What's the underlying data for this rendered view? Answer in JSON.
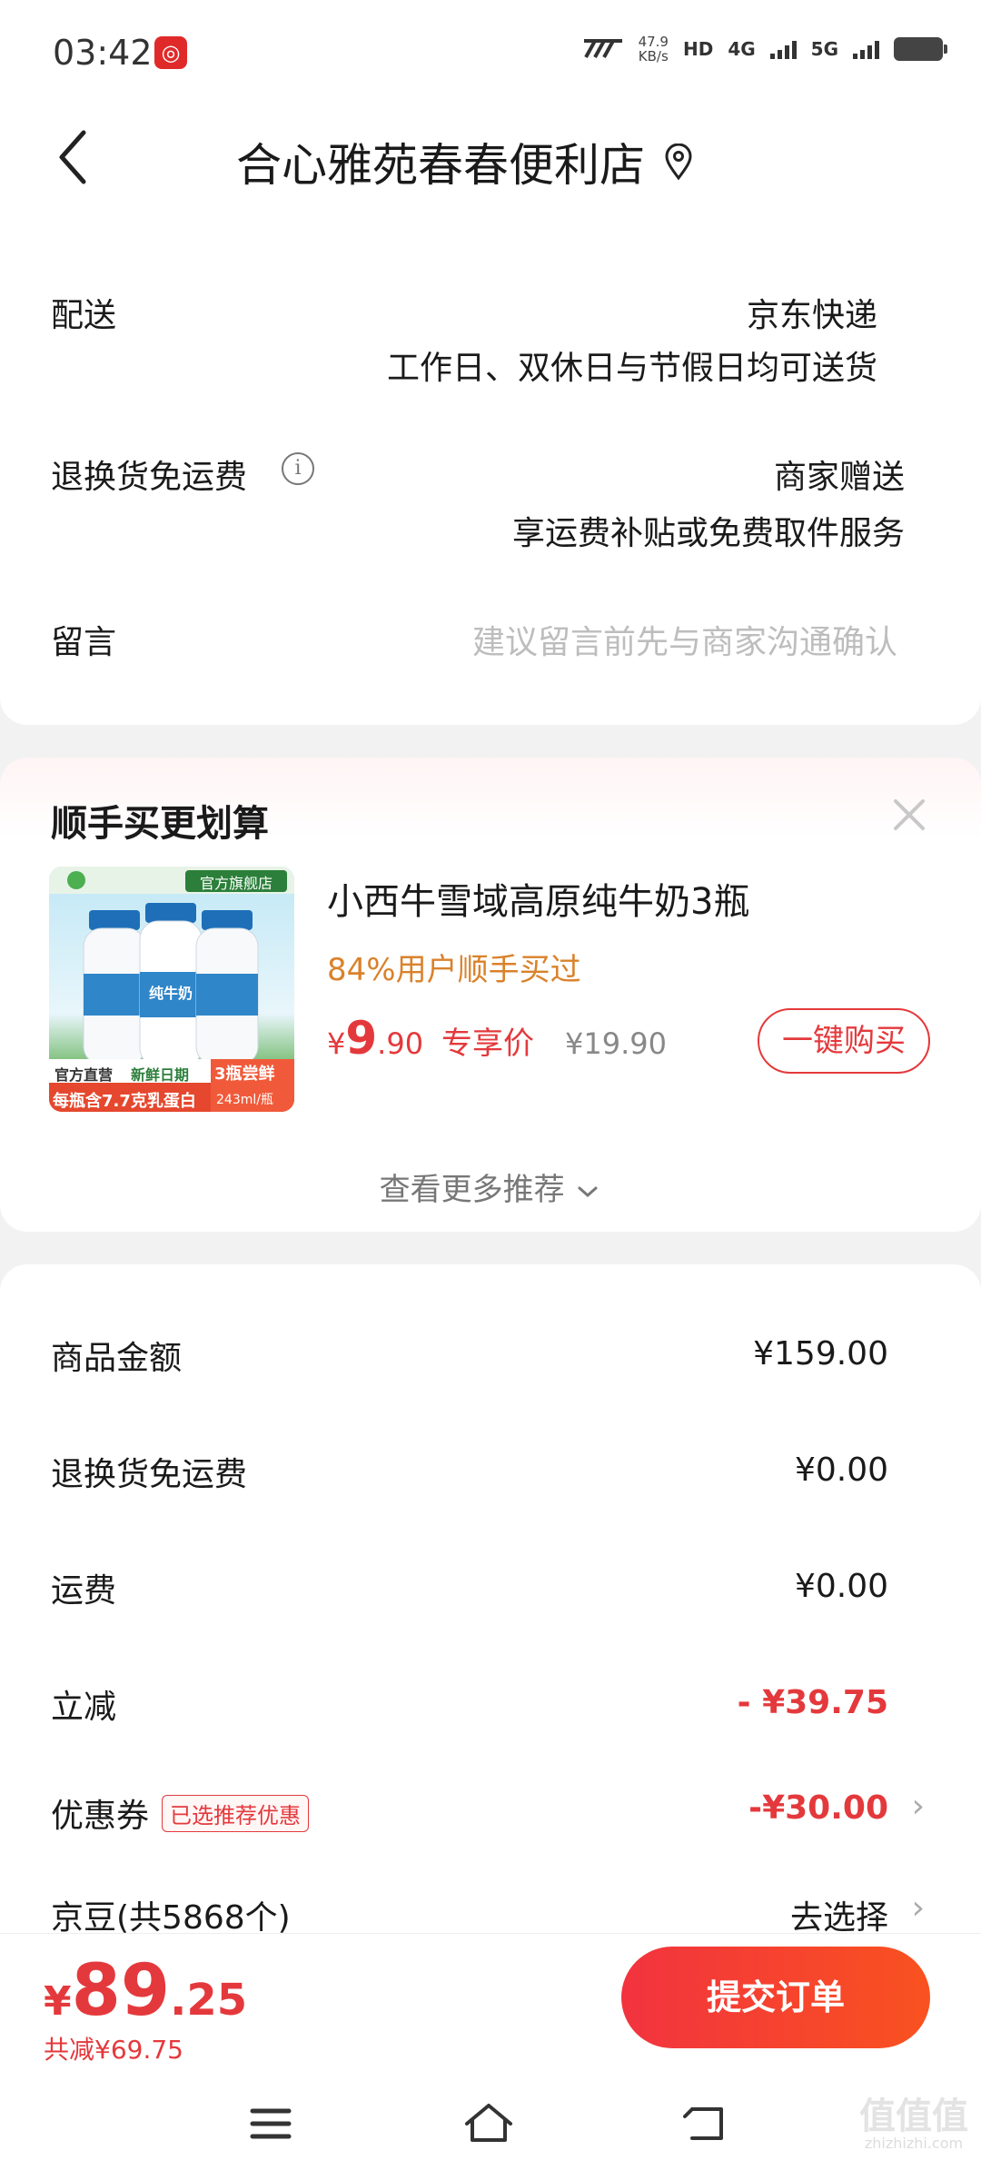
{
  "status_bar": {
    "time": "03:42",
    "net_speed_value": "47.9",
    "net_speed_unit": "KB/s",
    "hd_label": "HD",
    "sig1_label": "4G",
    "sig2_label": "5G"
  },
  "header": {
    "shop_name": "合心雅苑春春便利店"
  },
  "delivery": {
    "label": "配送",
    "carrier": "京东快递",
    "schedule": "工作日、双休日与节假日均可送货"
  },
  "return_shipping": {
    "label": "退换货免运费",
    "value": "商家赠送",
    "desc": "享运费补贴或免费取件服务"
  },
  "message": {
    "label": "留言",
    "placeholder": "建议留言前先与商家沟通确认"
  },
  "recommend": {
    "title": "顺手买更划算",
    "product": {
      "name": "小西牛雪域高原纯牛奶3瓶",
      "buyers_note": "84%用户顺手买过",
      "price_symbol": "¥",
      "price_int": "9",
      "price_dec": ".90",
      "price_tag": "专享价",
      "original_price": "¥19.90",
      "buy_label": "一键购买",
      "img_badge": "官方旗舰店",
      "img_bottle_label": "纯牛奶",
      "img_tag1": "官方直营",
      "img_tag2": "新鲜日期",
      "img_banner": "每瓶含7.7克乳蛋白",
      "img_corner": "3瓶尝鲜",
      "img_volume": "243ml/瓶"
    },
    "more_label": "查看更多推荐"
  },
  "amounts": {
    "goods_label": "商品金额",
    "goods_value": "¥159.00",
    "return_label": "退换货免运费",
    "return_value": "¥0.00",
    "shipping_label": "运费",
    "shipping_value": "¥0.00",
    "discount_label": "立减",
    "discount_value": "- ¥39.75",
    "coupon_label": "优惠券",
    "coupon_badge": "已选推荐优惠",
    "coupon_value": "-¥30.00",
    "beans_label": "京豆(共5868个)",
    "beans_value": "去选择"
  },
  "bottom": {
    "total_symbol": "¥",
    "total_int": "89",
    "total_dec": ".25",
    "saved": "共减¥69.75",
    "submit_label": "提交订单"
  },
  "watermark": {
    "main": "值值值",
    "sub": "zhizhizhi.com"
  },
  "colors": {
    "accent_red": "#e4393c",
    "buyers_orange": "#d9822b",
    "submit_gradient_start": "#f2333f",
    "submit_gradient_end": "#f9521f"
  }
}
